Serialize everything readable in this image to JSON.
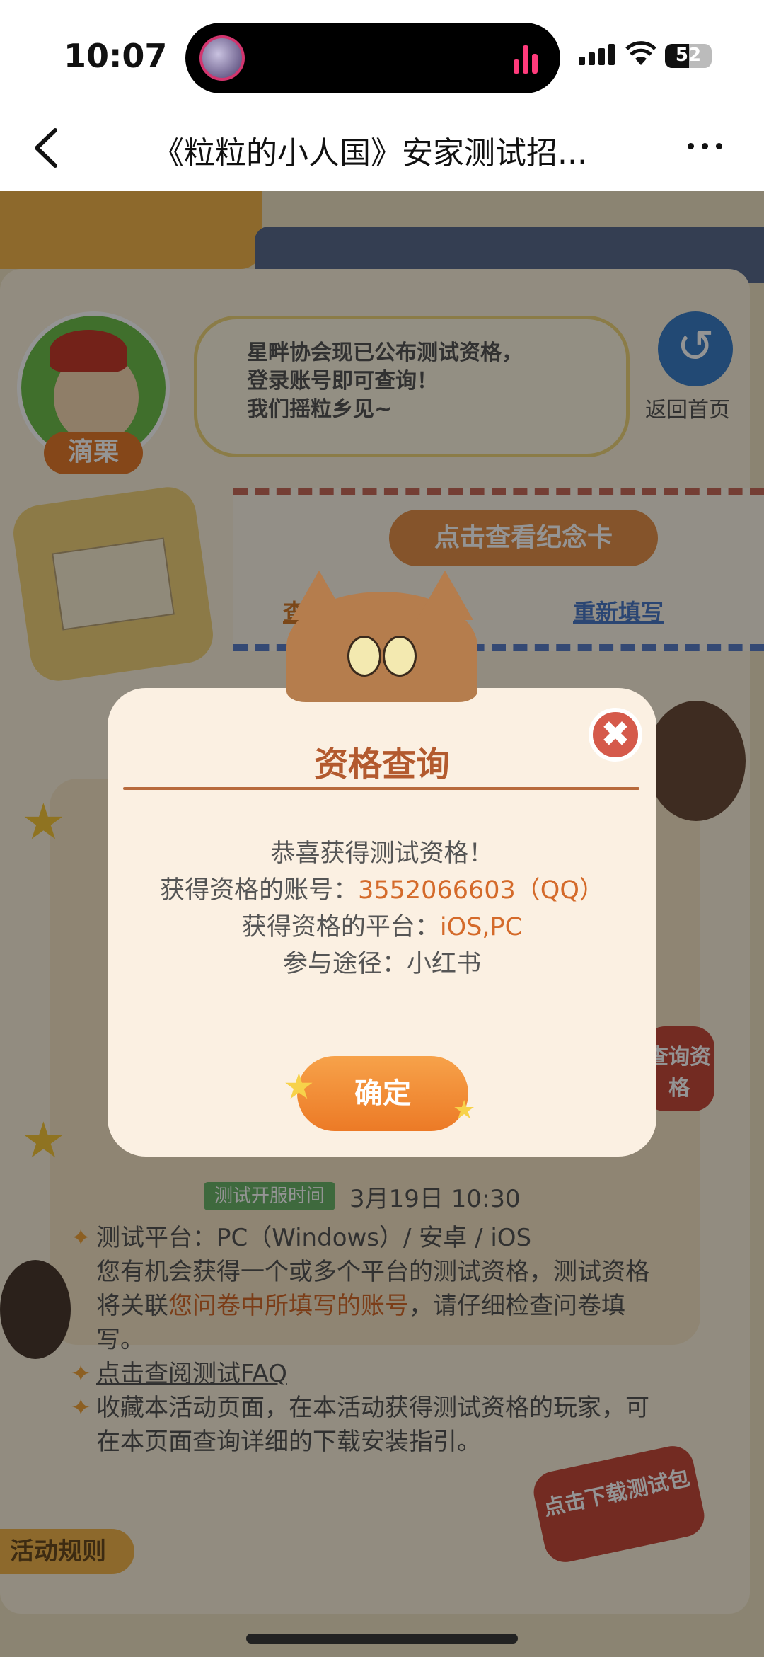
{
  "status_bar": {
    "time": "10:07",
    "battery": "52",
    "battery_level": 0.52
  },
  "nav": {
    "title": "《粒粒的小人国》安家测试招..."
  },
  "background": {
    "avatar_name": "滴栗",
    "bubble_text": [
      "星畔协会现已公布测试资格，",
      "登录账号即可查询！",
      "我们摇粒乡见~"
    ],
    "home_label": "返回首页",
    "memorial_card": "点击查看纪念卡",
    "view_record": "查看问卷填写记录",
    "refill": "重新填写",
    "launch_tag": "测试开服时间",
    "launch_time": "3月19日 10:30",
    "lines": {
      "platform": "测试平台：PC（Windows）/ 安卓 / iOS",
      "chance_a": "您有机会获得一个或多个平台的测试资格，测试资格将关联",
      "chance_hl": "您问卷中所填写的账号",
      "chance_b": "，请仔细检查问卷填写。",
      "faq": "点击查阅测试FAQ",
      "collect": "收藏本活动页面，在本活动获得测试资格的玩家，可在本页面查询详细的下载安装指引。"
    },
    "rules": "活动规则",
    "download": "点击下载测试包",
    "side_query": "查询资格"
  },
  "modal": {
    "title": "资格查询",
    "congrats": "恭喜获得测试资格！",
    "account_label": "获得资格的账号：",
    "account_value": "3552066603（QQ）",
    "platform_label": "获得资格的平台：",
    "platform_value": "iOS,PC",
    "channel_label": "参与途径：",
    "channel_value": "小红书",
    "confirm": "确定"
  }
}
